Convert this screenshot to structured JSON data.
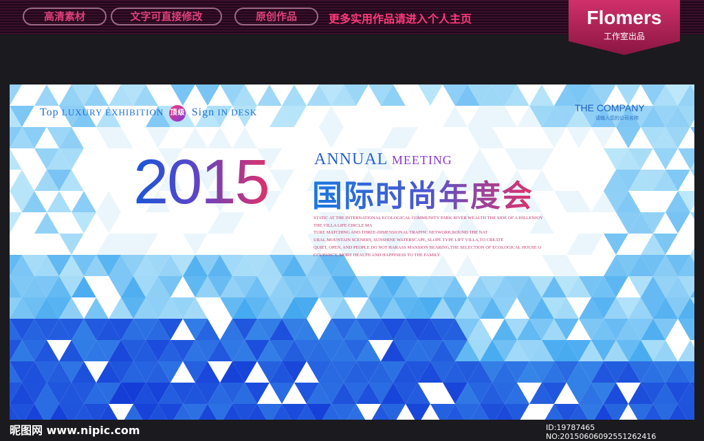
{
  "topbar": {
    "pills": [
      "高清素材",
      "文字可直接修改",
      "原创作品"
    ],
    "promo": "更多实用作品请进入个人主页",
    "brand_name": "Flomers",
    "brand_sub": "工作室出品"
  },
  "poster": {
    "tagline_words": [
      "Top",
      "luxury",
      "exhibition",
      "Sign",
      "in",
      "desk"
    ],
    "badge": "顶级",
    "company": "THE COMPANY",
    "company_sub": "请输入您的公司名称",
    "year": "2015",
    "annual": "Annual",
    "meeting": "meeting",
    "title_cn": "国际时尚年度会",
    "body_lines": [
      "STATIC AT THE INTERNATIONAL ECOLOGICAL COMMUNITY PARK RIVER WEALTH THE SIDE OF A HILLENJOY",
      "THE VILLA LIFE CIRCLE MA",
      "TURE MATCHING AND THREE-DIMENSIONAL TRAFFIC NETWORK,ROUND THE NAT",
      "URAL MOUNTAIN SCENERY, SUNSHINE WATERSCAPE, SLOPE TYPE LIFT VILLA,TO CREATE",
      "QUIET, OPEN, AND PEOPLE DO NOT HARASS MANSION BEARING,THE SELECTION OF ECOLOGICAL HOUSE O",
      "CCUPANCY, MORE HEALTH AND HAPPINESS TO THE FAMILY."
    ]
  },
  "footer": {
    "left": "昵图网 www.nipic.com",
    "right": "ID:19787465 NO:20150606092551262416"
  },
  "colors": {
    "accent_pink": "#e0306a",
    "accent_blue": "#1858d8",
    "background": "#1a1a1f"
  }
}
